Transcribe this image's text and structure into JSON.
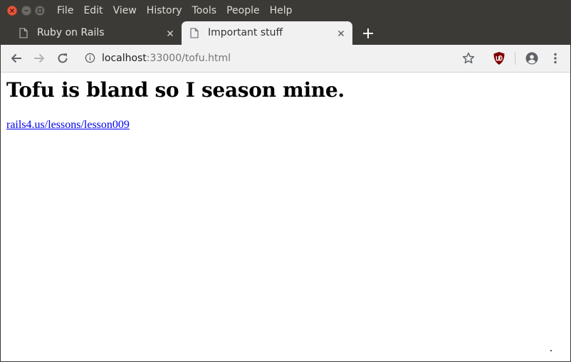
{
  "menubar": {
    "items": [
      "File",
      "Edit",
      "View",
      "History",
      "Tools",
      "People",
      "Help"
    ]
  },
  "tabs": [
    {
      "title": "Ruby on Rails",
      "active": false
    },
    {
      "title": "Important stuff",
      "active": true
    }
  ],
  "toolbar": {
    "url_host": "localhost",
    "url_rest": ":33000/tofu.html"
  },
  "page": {
    "heading": "Tofu is bland so I season mine.",
    "link_text": "rails4.us/lessons/lesson009"
  },
  "icons": {
    "back": "arrow-left-icon",
    "forward": "arrow-right-icon",
    "reload": "reload-icon",
    "info": "info-icon",
    "bookmark": "star-icon",
    "extension": "ublock-origin-icon",
    "profile": "account-icon",
    "menu": "kebab-menu-icon"
  },
  "colors": {
    "titlebar": "#3b3a36",
    "active_tab": "#f1f1f1",
    "close_button": "#e9573d",
    "link": "#0000ee",
    "ublock": "#800000"
  }
}
